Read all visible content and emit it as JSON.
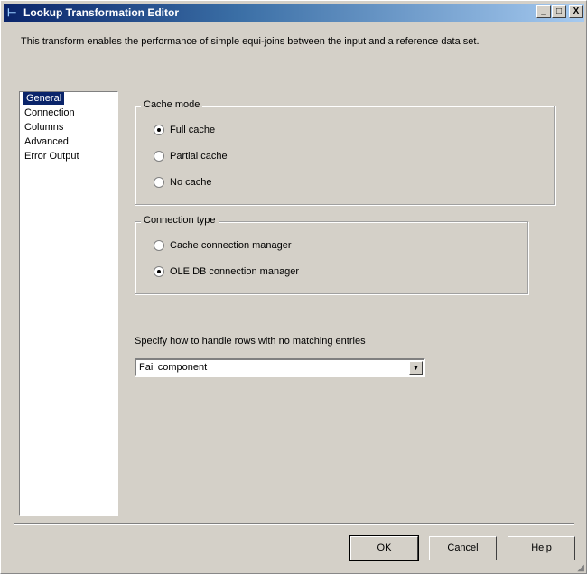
{
  "window": {
    "title": "Lookup Transformation Editor",
    "minimize": "_",
    "maximize": "□",
    "close": "X"
  },
  "description": "This transform enables the performance of simple equi-joins between the input and a reference data set.",
  "nav": {
    "items": [
      {
        "label": "General",
        "selected": true
      },
      {
        "label": "Connection"
      },
      {
        "label": "Columns"
      },
      {
        "label": "Advanced"
      },
      {
        "label": "Error Output"
      }
    ]
  },
  "cache_mode": {
    "legend": "Cache mode",
    "options": [
      {
        "label": "Full cache",
        "checked": true
      },
      {
        "label": "Partial cache",
        "checked": false
      },
      {
        "label": "No cache",
        "checked": false
      }
    ]
  },
  "connection_type": {
    "legend": "Connection type",
    "options": [
      {
        "label": "Cache connection manager",
        "checked": false
      },
      {
        "label": "OLE DB connection manager",
        "checked": true
      }
    ]
  },
  "no_match": {
    "label": "Specify how to handle rows with no matching entries",
    "value": "Fail component"
  },
  "buttons": {
    "ok": "OK",
    "cancel": "Cancel",
    "help": "Help"
  }
}
